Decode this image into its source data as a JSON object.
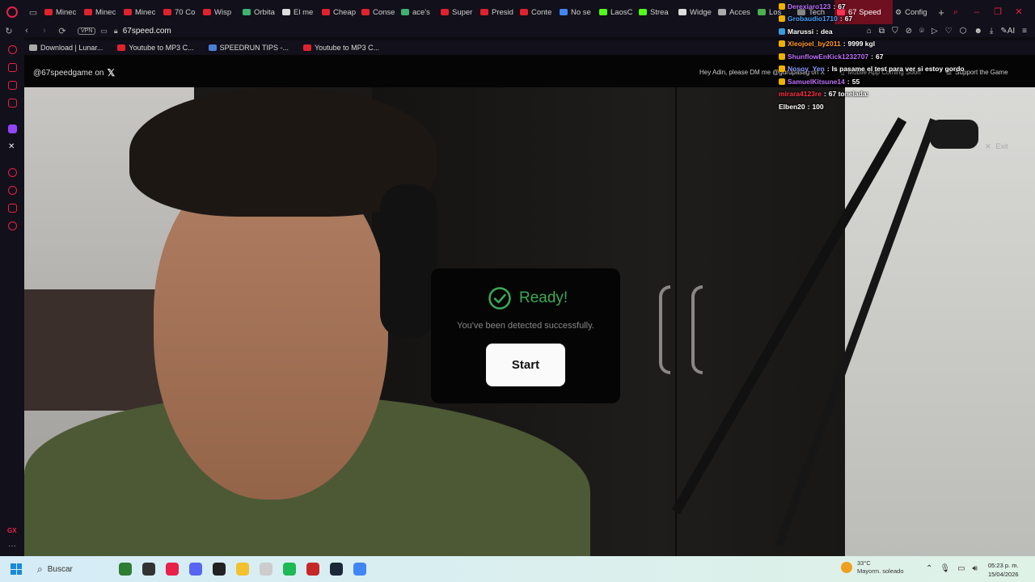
{
  "browser": {
    "tabs": [
      {
        "label": "Minec",
        "color": "#e0222f"
      },
      {
        "label": "Minec",
        "color": "#e0222f"
      },
      {
        "label": "Minec",
        "color": "#e0222f"
      },
      {
        "label": "70 Co",
        "color": "#e0222f"
      },
      {
        "label": "Wisp",
        "color": "#e0222f"
      },
      {
        "label": "Orbita",
        "color": "#3cb371"
      },
      {
        "label": "El me",
        "color": "#dddddd"
      },
      {
        "label": "Cheap",
        "color": "#e0222f"
      },
      {
        "label": "Conse",
        "color": "#e0222f"
      },
      {
        "label": "ace's",
        "color": "#3cb371"
      },
      {
        "label": "Super",
        "color": "#e0222f"
      },
      {
        "label": "Presid",
        "color": "#e0222f"
      },
      {
        "label": "Conte",
        "color": "#e0222f"
      },
      {
        "label": "No se",
        "color": "#4285f4"
      },
      {
        "label": "LaosC",
        "color": "#53fc18"
      },
      {
        "label": "Strea",
        "color": "#53fc18"
      },
      {
        "label": "Widge",
        "color": "#dddddd"
      },
      {
        "label": "Acces",
        "color": "#aaaaaa"
      },
      {
        "label": "Los",
        "color": "#4caf50"
      },
      {
        "label": "Tech",
        "color": "#888888"
      }
    ],
    "active_tab": {
      "label": "67 Speed",
      "color": "#ff3355"
    },
    "last_tab": {
      "label": "Config"
    },
    "url": "67speed.com",
    "vpn_label": "VPN",
    "ai_label": "AI",
    "bookmarks": [
      {
        "label": "Download | Lunar...",
        "color": "#aaaaaa"
      },
      {
        "label": "Youtube to MP3 C...",
        "color": "#e0222f"
      },
      {
        "label": "SPEEDRUN TIPS -...",
        "color": "#4a7fd6"
      },
      {
        "label": "Youtube to MP3 C...",
        "color": "#e0222f"
      }
    ],
    "sidebar_gx": "GX"
  },
  "site": {
    "social_handle": "@67speedgame on",
    "dm_text": "Hey Adin, please DM me @gurupasag on X",
    "mobile_app": "Mobile App Coming Soon",
    "support": "Support the Game",
    "exit": "Exit",
    "modal": {
      "title": "Ready!",
      "subtitle": "You've been detected successfully.",
      "start_label": "Start"
    }
  },
  "chat": [
    {
      "user": "Derexiaro123",
      "msg": "67",
      "color": "#c070ff",
      "badge": "#f0b000"
    },
    {
      "user": "Grobaudio1710",
      "msg": "67",
      "color": "#4aa0ff",
      "badge": "#f0b000"
    },
    {
      "user": "Marussi",
      "msg": "dea",
      "color": "#ffffff",
      "badge": "#3a9bdc"
    },
    {
      "user": "Xleojoel_by2011",
      "msg": "9999 kgl",
      "color": "#ff9a2a",
      "badge": "#f0b000"
    },
    {
      "user": "ShunflowEnKick1232707",
      "msg": "67",
      "color": "#c070ff",
      "badge": "#f0b000"
    },
    {
      "user": "Nosoy_Yen",
      "msg": "Is pasame el test para ver si estoy gordo",
      "color": "#8a9aff",
      "badge": "#f0b000"
    },
    {
      "user": "SamuelKitsune14",
      "msg": "55",
      "color": "#c070ff",
      "badge": "#f0b000"
    },
    {
      "user": "mirara4123re",
      "msg": "67 tonelada:",
      "color": "#ff3344",
      "badge": ""
    },
    {
      "user": "Elben20",
      "msg": "100",
      "color": "#ffffff",
      "badge": ""
    }
  ],
  "taskbar": {
    "search_placeholder": "Buscar",
    "apps": [
      {
        "name": "widgets",
        "color": "#2e7d32"
      },
      {
        "name": "file-explorer-dark",
        "color": "#333333"
      },
      {
        "name": "opera",
        "color": "#e8214a"
      },
      {
        "name": "discord",
        "color": "#5865f2"
      },
      {
        "name": "media",
        "color": "#222222"
      },
      {
        "name": "folder",
        "color": "#f2c12e"
      },
      {
        "name": "tool",
        "color": "#cccccc"
      },
      {
        "name": "spotify",
        "color": "#1db954"
      },
      {
        "name": "game",
        "color": "#c62828"
      },
      {
        "name": "steam",
        "color": "#1b2838"
      },
      {
        "name": "chrome",
        "color": "#4285f4"
      }
    ],
    "weather_temp": "33°C",
    "weather_desc": "Mayorm. soleado",
    "time": "05:23 p. m.",
    "date": "15/04/2026"
  }
}
